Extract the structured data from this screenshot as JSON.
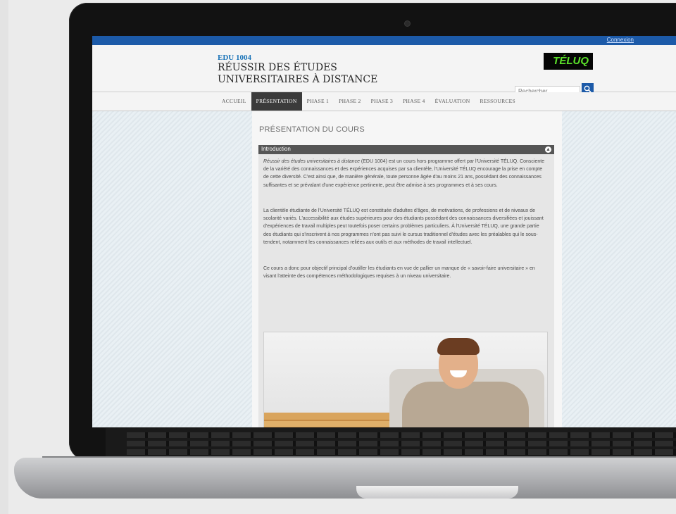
{
  "site": {
    "login_link": "Connexion",
    "course_code": "EDU 1004",
    "course_title_line1": "RÉUSSIR DES ÉTUDES",
    "course_title_line2": "UNIVERSITAIRES À DISTANCE",
    "logo_text": "TÉLUQ",
    "search": {
      "placeholder": "Rechercher"
    }
  },
  "nav": {
    "items": [
      {
        "label": "ACCUEIL"
      },
      {
        "label": "PRÉSENTATION"
      },
      {
        "label": "PHASE 1"
      },
      {
        "label": "PHASE 2"
      },
      {
        "label": "PHASE 3"
      },
      {
        "label": "PHASE 4"
      },
      {
        "label": "ÉVALUATION"
      },
      {
        "label": "RESSOURCES"
      }
    ],
    "active_index": 1
  },
  "content": {
    "page_heading": "PRÉSENTATION DU COURS",
    "section_title": "Introduction",
    "paragraphs": [
      "Réussir des études universitaires à distance (EDU 1004) est un cours hors programme offert par l'Université TÉLUQ. Consciente de la variété des connaissances et des expériences acquises par sa clientèle, l'Université TÉLUQ encourage la prise en compte de cette diversité. C'est ainsi que, de manière générale, toute personne âgée d'au moins 21 ans, possédant des connaissances suffisantes et se prévalant d'une expérience pertinente, peut être admise à ses programmes et à ses cours.",
      "La clientèle étudiante de l'Université TÉLUQ est constituée d'adultes d'âges, de motivations, de professions et de niveaux de scolarité variés. L'accessibilité aux études supérieures pour des étudiants possédant des connaissances diversifiées et jouissant d'expériences de travail multiples peut toutefois poser certains problèmes particuliers. À l'Université TÉLUQ, une grande partie des étudiants qui s'inscrivent à nos programmes n'ont pas suivi le cursus traditionnel d'études avec les préalables qui le sous-tendent, notamment les connaissances reliées aux outils et aux méthodes de travail intellectuel.",
      "Ce cours a donc pour objectif principal d'outiller les étudiants en vue de pallier un manque de « savoir-faire universitaire » en visant l'atteinte des compétences méthodologiques requises à un niveau universitaire."
    ]
  },
  "colors": {
    "topbar": "#1c5aa8",
    "course_code": "#1b74b8",
    "logo_text": "#5be12a",
    "nav_active_bg": "#3b3b3b"
  }
}
